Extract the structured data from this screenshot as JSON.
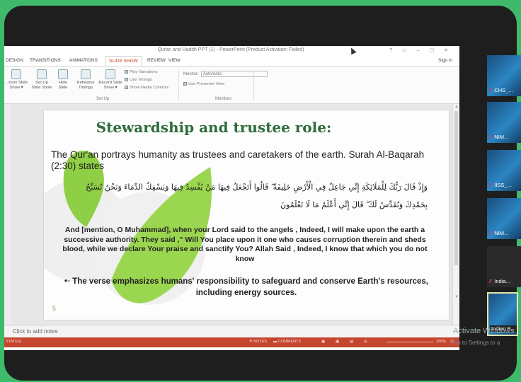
{
  "window": {
    "title": "Quran and Hadith PPT (1) - PowerPoint (Product Activation Failed)",
    "controls": "?  ▭  –  ▢  ✕"
  },
  "tabs": [
    "DESIGN",
    "TRANSITIONS",
    "ANIMATIONS",
    "SLIDE SHOW",
    "REVIEW",
    "VIEW"
  ],
  "active_tab": "SLIDE SHOW",
  "sign_in": "Sign in",
  "ribbon": {
    "buttons": [
      {
        "label": "...stom Slide Show ▾"
      },
      {
        "label": "Set Up Slide Show"
      },
      {
        "label": "Hide Slide"
      },
      {
        "label": "Rehearse Timings"
      },
      {
        "label": "Record Slide Show ▾"
      }
    ],
    "checks": [
      "Play Narrations",
      "Use Timings",
      "Show Media Controls"
    ],
    "setup_group": "Set Up",
    "monitor_label": "Monitor:",
    "monitor_value": "Automatic",
    "presenter_view": "Use Presenter View",
    "monitors_group": "Monitors"
  },
  "slide": {
    "title": "Stewardship and trustee role:",
    "body": "The Qur'an portrays humanity as trustees and caretakers of the earth. Surah Al-Baqarah (2:30) states",
    "arabic": "وَإِذْ قَالَ رَبُّكَ لِلْمَلَائِكَةِ إِنِّي جَاعِلٌ فِي الْأَرْضِ خَلِيفَةً ۖ قَالُوا أَتَجْعَلُ فِيهَا مَنْ يُفْسِدُ فِيهَا وَيَسْفِكُ الدِّمَاءَ وَنَحْنُ نُسَبِّحُ بِحَمْدِكَ وَنُقَدِّسُ لَكَ ۖ قَالَ إِنِّي أَعْلَمُ مَا لَا تَعْلَمُونَ",
    "translation": "And [mention, O Muhammad], when your Lord said to the angels , Indeed, I will make upon the earth a successive authority. They said ,\" Will You place upon it one who causes corruption therein and sheds blood, while we declare Your praise and sanctify You? Allah Said , Indeed, I know that which you do not know",
    "emphasis": "•◦ The verse emphasizes humans' responsibility to safeguard and conserve Earth's resources, including energy sources.",
    "number": "5"
  },
  "notes_placeholder": "Click to add notes",
  "status": {
    "left": "STATES)",
    "notes": "≙ NOTES",
    "comments": "▬ COMMENTS",
    "zoom": "100%"
  },
  "participants": [
    "CHS_...",
    "NIM...",
    "IISS_...",
    "NIM...",
    "India...",
    "Indian B..."
  ],
  "activation": {
    "line1": "Activate Windows",
    "line2": "Go to Settings to a"
  },
  "colors": {
    "zoom_bg": "#3fba6a",
    "title_green": "#2e6b3a",
    "status_red": "#c5462c",
    "tab_active": "#c43e1c"
  }
}
